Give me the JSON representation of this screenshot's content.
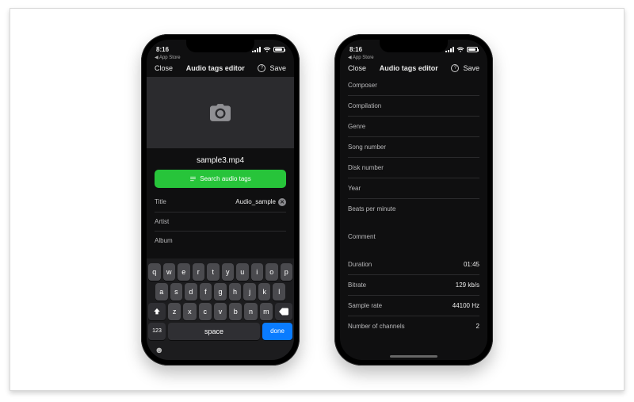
{
  "phone1": {
    "status": {
      "time": "8:16",
      "back_link": "App Store"
    },
    "nav": {
      "close": "Close",
      "title": "Audio tags editor",
      "save": "Save"
    },
    "filename": "sample3.mp4",
    "search_button": "Search audio tags",
    "fields": {
      "title_label": "Title",
      "title_value": "Audio_sample",
      "artist_label": "Artist",
      "album_label": "Album"
    },
    "keyboard": {
      "row1": [
        "q",
        "w",
        "e",
        "r",
        "t",
        "y",
        "u",
        "i",
        "o",
        "p"
      ],
      "row2": [
        "a",
        "s",
        "d",
        "f",
        "g",
        "h",
        "j",
        "k",
        "l"
      ],
      "row3": [
        "z",
        "x",
        "c",
        "v",
        "b",
        "n",
        "m"
      ],
      "num": "123",
      "space": "space",
      "done": "done"
    }
  },
  "phone2": {
    "status": {
      "time": "8:16",
      "back_link": "App Store"
    },
    "nav": {
      "close": "Close",
      "title": "Audio tags editor",
      "save": "Save"
    },
    "editable_fields": [
      {
        "label": "Composer"
      },
      {
        "label": "Compilation"
      },
      {
        "label": "Genre"
      },
      {
        "label": "Song number"
      },
      {
        "label": "Disk number"
      },
      {
        "label": "Year"
      },
      {
        "label": "Beats per minute"
      }
    ],
    "comment_label": "Comment",
    "info_rows": [
      {
        "label": "Duration",
        "value": "01:45"
      },
      {
        "label": "Bitrate",
        "value": "129 kb/s"
      },
      {
        "label": "Sample rate",
        "value": "44100 Hz"
      },
      {
        "label": "Number of channels",
        "value": "2"
      }
    ]
  }
}
